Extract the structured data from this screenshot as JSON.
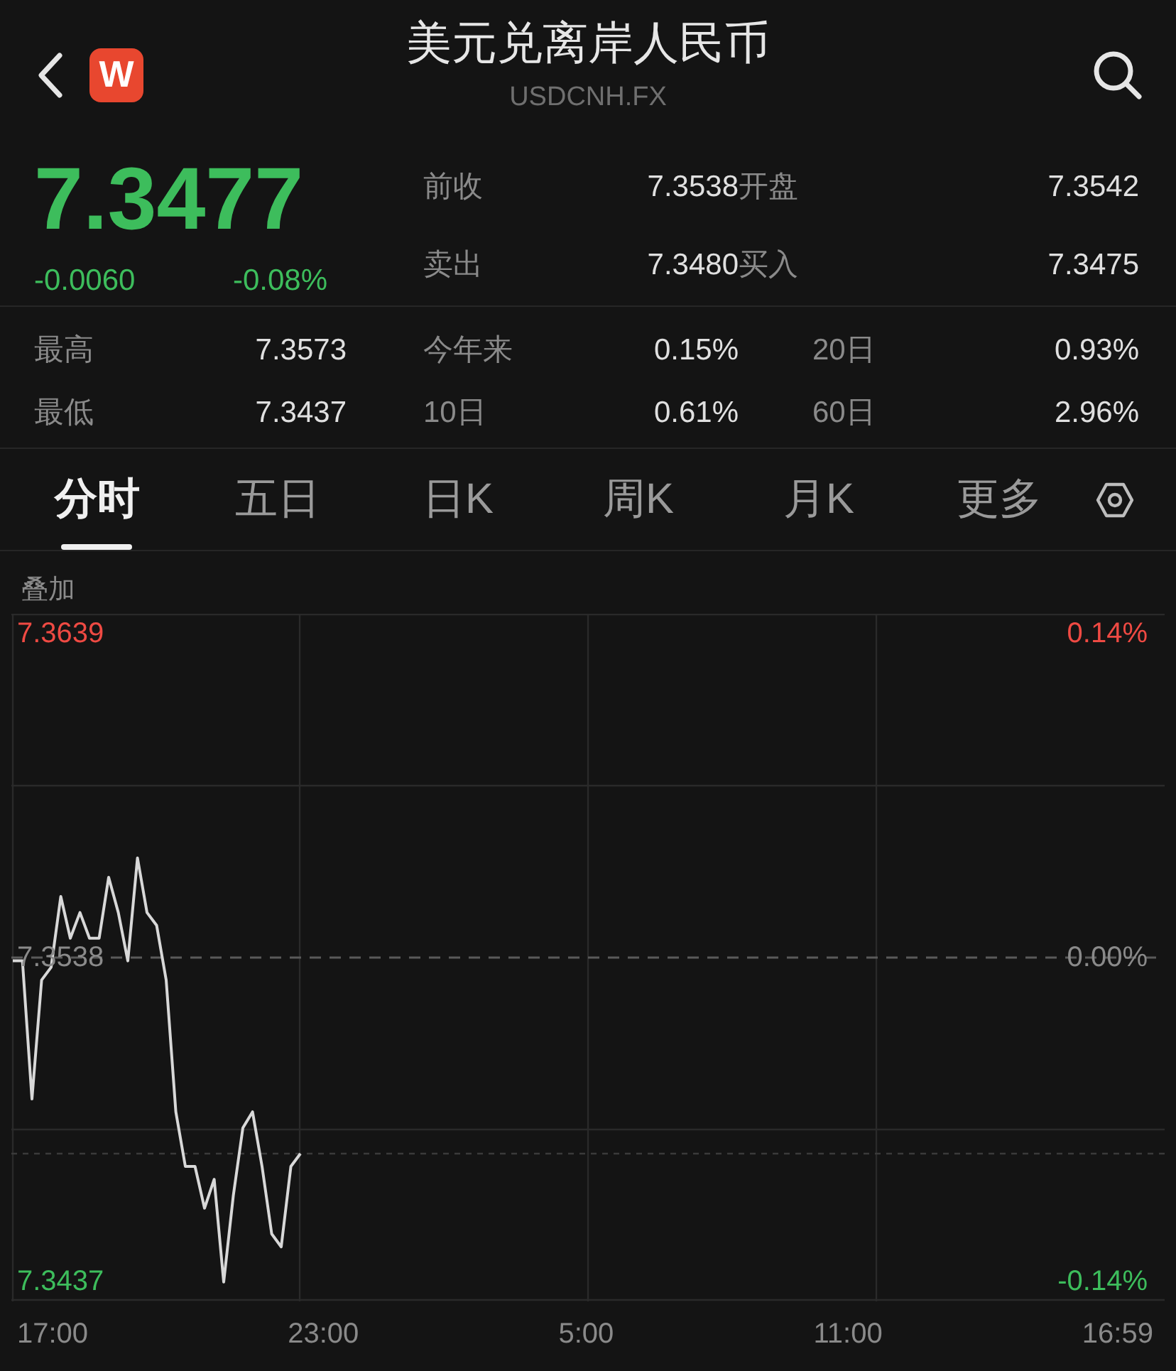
{
  "header": {
    "title": "美元兑离岸人民币",
    "subtitle": "USDCNH.FX",
    "logo_letter": "W"
  },
  "quote": {
    "price": "7.3477",
    "change": "-0.0060",
    "change_pct": "-0.08%",
    "color": "#3dbd5c",
    "fields": [
      {
        "label": "前收",
        "value": "7.3538"
      },
      {
        "label": "开盘",
        "value": "7.3542"
      },
      {
        "label": "卖出",
        "value": "7.3480"
      },
      {
        "label": "买入",
        "value": "7.3475"
      }
    ]
  },
  "stats": [
    {
      "label": "最高",
      "value": "7.3573"
    },
    {
      "label": "今年来",
      "value": "0.15%"
    },
    {
      "label": "20日",
      "value": "0.93%"
    },
    {
      "label": "最低",
      "value": "7.3437"
    },
    {
      "label": "10日",
      "value": "0.61%"
    },
    {
      "label": "60日",
      "value": "2.96%"
    }
  ],
  "tabs": [
    {
      "label": "分时",
      "selected": true
    },
    {
      "label": "五日",
      "selected": false
    },
    {
      "label": "日K",
      "selected": false
    },
    {
      "label": "周K",
      "selected": false
    },
    {
      "label": "月K",
      "selected": false
    },
    {
      "label": "更多",
      "selected": false
    }
  ],
  "overlay_label": "叠加",
  "chart": {
    "right_labels": [
      {
        "text": "0.14%",
        "color": "#ef4a43"
      },
      {
        "text": "0.00%",
        "color": "#8a8a8a"
      },
      {
        "text": "-0.14%",
        "color": "#3dbd5c"
      }
    ],
    "chart_data": {
      "type": "line",
      "categories": [
        null,
        null,
        null,
        null,
        null,
        null,
        null,
        null,
        null,
        null,
        null,
        null,
        null,
        null,
        null,
        null,
        null,
        null,
        null,
        null,
        null,
        null,
        null,
        null,
        null,
        null,
        null,
        null,
        null,
        null,
        null,
        null,
        null,
        null,
        null,
        null,
        null,
        null,
        null,
        null,
        null,
        null,
        null,
        null,
        null,
        null,
        null,
        null,
        null,
        null,
        null,
        null,
        null,
        null,
        null,
        null,
        null,
        null,
        null,
        null,
        null,
        null,
        null,
        null,
        null,
        null,
        null,
        null,
        null,
        null,
        null,
        null,
        null,
        null,
        null,
        null,
        null,
        null,
        null,
        null,
        null,
        null,
        null,
        null,
        null,
        null,
        null,
        null,
        null,
        null,
        null,
        null,
        null,
        null,
        null,
        null,
        null,
        null,
        null,
        null,
        null,
        null,
        null,
        null,
        null,
        null,
        null,
        null,
        null,
        null,
        null,
        null,
        null,
        null,
        null,
        null,
        null,
        null,
        null,
        null,
        null
      ],
      "series": [
        {
          "color": "#d8d8d8",
          "values": [
            7.3537,
            7.3537,
            7.3494,
            7.3531,
            7.3535,
            7.3557,
            7.3544,
            7.3552,
            7.3544,
            7.3544,
            7.3563,
            7.3552,
            7.3537,
            7.3569,
            7.3552,
            7.3548,
            7.3531,
            7.349,
            7.3473,
            7.3473,
            7.346,
            7.3469,
            7.3437,
            7.3464,
            7.3485,
            7.349,
            7.3473,
            7.3452,
            7.3448,
            7.3473,
            7.3477,
            null,
            null,
            null,
            null,
            null,
            null,
            null,
            null,
            null,
            null,
            null,
            null,
            null,
            null,
            null,
            null,
            null,
            null,
            null,
            null,
            null,
            null,
            null,
            null,
            null,
            null,
            null,
            null,
            null,
            null,
            null,
            null,
            null,
            null,
            null,
            null,
            null,
            null,
            null,
            null,
            null,
            null,
            null,
            null,
            null,
            null,
            null,
            null,
            null,
            null,
            null,
            null,
            null,
            null,
            null,
            null,
            null,
            null,
            null,
            null,
            null,
            null,
            null,
            null,
            null,
            null,
            null,
            null,
            null,
            null,
            null,
            null,
            null,
            null,
            null,
            null,
            null,
            null,
            null,
            null,
            null,
            null,
            null,
            null,
            null,
            null,
            null,
            null,
            null,
            null
          ]
        }
      ],
      "ref_lines": [
        {
          "axis": "y",
          "value": 7.3538
        },
        {
          "axis": "y",
          "value": 7.3477
        }
      ],
      "ylim": [
        7.3431,
        7.3645
      ],
      "yticks": [
        {
          "value": 7.3639,
          "label": "7.3639"
        },
        {
          "value": 7.3538,
          "label": "7.3538"
        },
        {
          "value": 7.3437,
          "label": "7.3437"
        }
      ]
    },
    "x_labels": [
      "17:00",
      "23:00",
      "5:00",
      "11:00",
      "16:59"
    ]
  }
}
